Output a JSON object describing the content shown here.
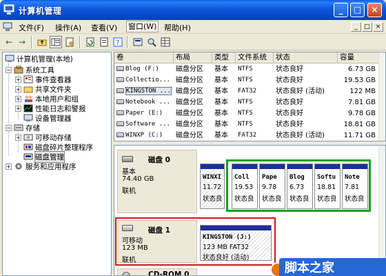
{
  "window": {
    "title": "计算机管理",
    "min": "_",
    "max": "□",
    "close": "×"
  },
  "menu": {
    "items": [
      {
        "label": "文件(F)"
      },
      {
        "label": "操作(A)"
      },
      {
        "label": "查看(V)"
      },
      {
        "label": "窗口(W)"
      },
      {
        "label": "帮助(H)"
      }
    ],
    "mdi": [
      "_",
      "□",
      "×"
    ]
  },
  "toolbar": {
    "back_icon": "back-arrow-icon",
    "forward_icon": "forward-arrow-icon"
  },
  "tree": {
    "root": "计算机管理(本地)",
    "nodes": [
      {
        "label": "系统工具",
        "level": 1,
        "expander": "−"
      },
      {
        "label": "事件查看器",
        "level": 2,
        "expander": "+"
      },
      {
        "label": "共享文件夹",
        "level": 2,
        "expander": "+"
      },
      {
        "label": "本地用户和组",
        "level": 2,
        "expander": "+"
      },
      {
        "label": "性能日志和警报",
        "level": 2,
        "expander": "+"
      },
      {
        "label": "设备管理器",
        "level": 2,
        "expander": ""
      },
      {
        "label": "存储",
        "level": 1,
        "expander": "−"
      },
      {
        "label": "可移动存储",
        "level": 2,
        "expander": "+"
      },
      {
        "label": "磁盘碎片整理程序",
        "level": 2,
        "expander": ""
      },
      {
        "label": "磁盘管理",
        "level": 2,
        "expander": ""
      },
      {
        "label": "服务和应用程序",
        "level": 1,
        "expander": "+"
      }
    ]
  },
  "volumes": {
    "columns": [
      "卷",
      "布局",
      "类型",
      "文件系统",
      "状态",
      "容量"
    ],
    "rows": [
      {
        "vol": "Blog (F:)",
        "layout": "磁盘分区",
        "type": "基本",
        "fs": "NTFS",
        "status": "状态良好",
        "cap": "6.73 GB"
      },
      {
        "vol": "Collectio...",
        "layout": "磁盘分区",
        "type": "基本",
        "fs": "NTFS",
        "status": "状态良好",
        "cap": "19.53 GB"
      },
      {
        "vol": "KINGSTON ...",
        "layout": "磁盘分区",
        "type": "基本",
        "fs": "FAT32",
        "status": "状态良好 (活动)",
        "cap": "122 MB"
      },
      {
        "vol": "Notebook ...",
        "layout": "磁盘分区",
        "type": "基本",
        "fs": "NTFS",
        "status": "状态良好",
        "cap": "7.81 GB"
      },
      {
        "vol": "Paper (E:)",
        "layout": "磁盘分区",
        "type": "基本",
        "fs": "NTFS",
        "status": "状态良好",
        "cap": "9.78 GB"
      },
      {
        "vol": "Software ...",
        "layout": "磁盘分区",
        "type": "基本",
        "fs": "NTFS",
        "status": "状态良好",
        "cap": "18.81 GB"
      },
      {
        "vol": "WINXP (C:)",
        "layout": "磁盘分区",
        "type": "基本",
        "fs": "FAT32",
        "status": "状态良好 (活动)",
        "cap": "11.71 GB"
      }
    ]
  },
  "disks": [
    {
      "name": "磁盘 0",
      "type": "基本",
      "size": "74.40 GB",
      "state": "联机",
      "partitions": [
        {
          "title": "WINXI",
          "size": "11.72",
          "status": "状态良"
        },
        {
          "title": "Coll",
          "size": "19.53",
          "status": "状态良"
        },
        {
          "title": "Pape",
          "size": "9.78",
          "status": "状态良"
        },
        {
          "title": "Blog",
          "size": "6.73",
          "status": "状态良"
        },
        {
          "title": "Softu",
          "size": "18.81",
          "status": "状态良"
        },
        {
          "title": "Note",
          "size": "7.81",
          "status": "状态良"
        }
      ]
    },
    {
      "name": "磁盘 1",
      "type": "可移动",
      "size": "123 MB",
      "state": "联机",
      "partitions": [
        {
          "title": "KINGSTON  (J:)",
          "size": "123 MB FAT32",
          "status": "状态良好 (活动)"
        }
      ]
    },
    {
      "name": "CD-ROM 0"
    }
  ],
  "watermark": {
    "text": "脚本之家"
  },
  "colors": {
    "accent_green": "#18a01e",
    "highlight_red": "#d01818",
    "partition_bar": "#1d2f9a"
  }
}
